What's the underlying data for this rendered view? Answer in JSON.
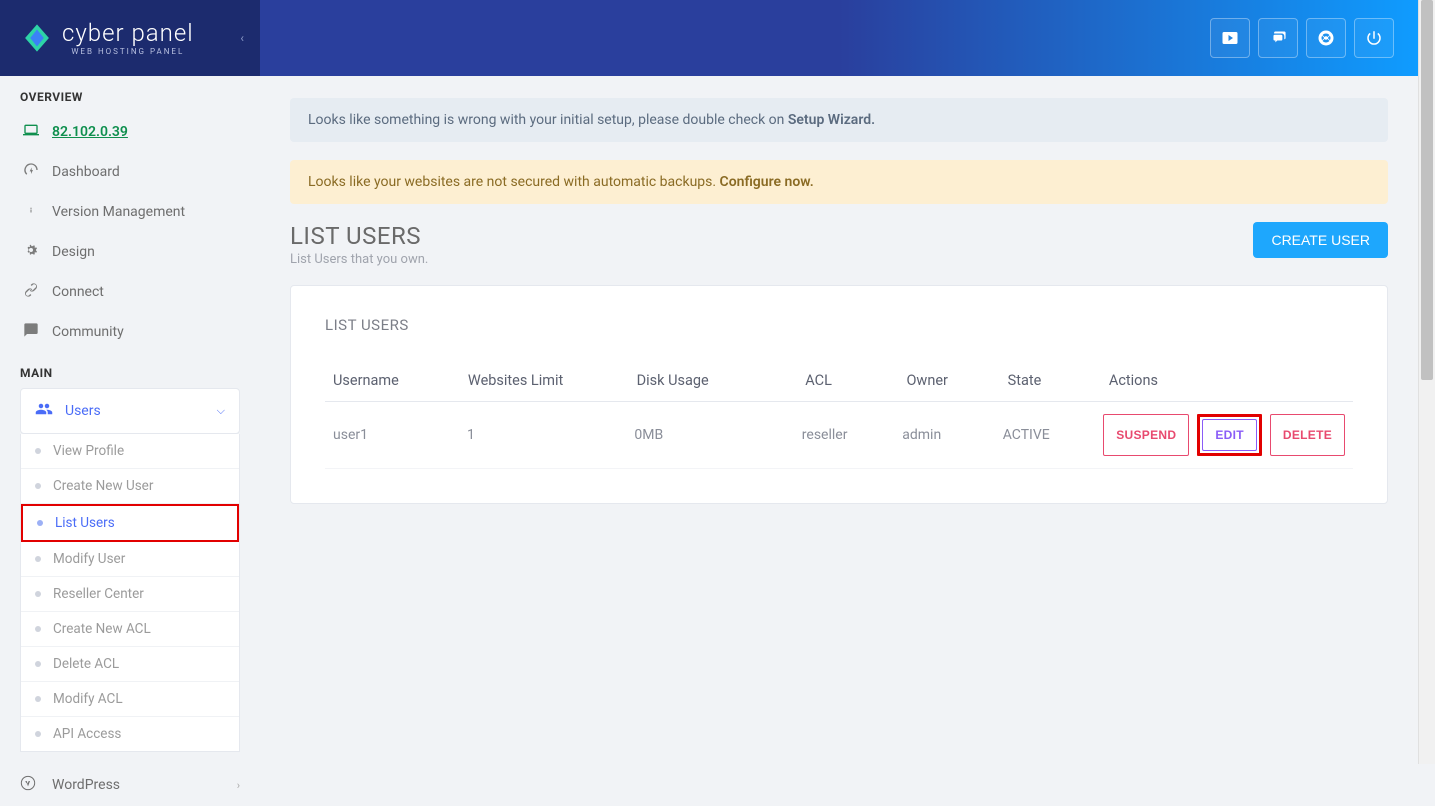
{
  "brand": {
    "name": "cyber panel",
    "subtitle": "WEB HOSTING PANEL"
  },
  "sidebar": {
    "section_overview": "OVERVIEW",
    "section_main": "MAIN",
    "ip": "82.102.0.39",
    "items": {
      "dashboard": "Dashboard",
      "version": "Version Management",
      "design": "Design",
      "connect": "Connect",
      "community": "Community",
      "users": "Users",
      "wordpress": "WordPress"
    },
    "users_submenu": [
      "View Profile",
      "Create New User",
      "List Users",
      "Modify User",
      "Reseller Center",
      "Create New ACL",
      "Delete ACL",
      "Modify ACL",
      "API Access"
    ]
  },
  "alerts": {
    "setup_text": "Looks like something is wrong with your initial setup, please double check on ",
    "setup_link": "Setup Wizard.",
    "backup_text": "Looks like your websites are not secured with automatic backups. ",
    "backup_link": "Configure now."
  },
  "page": {
    "title": "LIST USERS",
    "subtitle": "List Users that you own.",
    "create_btn": "CREATE USER",
    "card_title": "LIST USERS"
  },
  "table": {
    "headers": [
      "Username",
      "Websites Limit",
      "Disk Usage",
      "ACL",
      "Owner",
      "State",
      "Actions"
    ],
    "row": {
      "username": "user1",
      "limit": "1",
      "disk": "0MB",
      "acl": "reseller",
      "owner": "admin",
      "state": "ACTIVE"
    },
    "actions": {
      "suspend": "SUSPEND",
      "edit": "EDIT",
      "delete": "DELETE"
    }
  }
}
